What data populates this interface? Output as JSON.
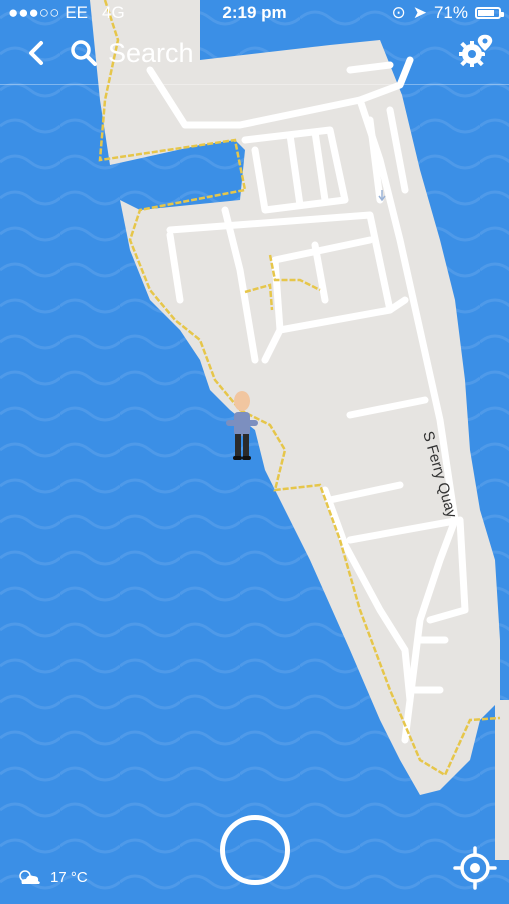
{
  "status_bar": {
    "carrier": "EE",
    "network": "4G",
    "time": "2:19 pm",
    "battery": "71%",
    "battery_level": 0.71
  },
  "search": {
    "label": "Search"
  },
  "map": {
    "street_label": "S Ferry Quay"
  },
  "weather": {
    "temperature": "17 °C",
    "icon": "partly-cloudy-icon"
  },
  "icons": {
    "back": "chevron-left-icon",
    "search": "search-icon",
    "settings": "gear-location-icon",
    "locate": "crosshair-icon"
  },
  "colors": {
    "water": "#3b8fe6",
    "land": "#e6e4e1",
    "road": "#ffffff",
    "footpath": "#e6c64a"
  }
}
